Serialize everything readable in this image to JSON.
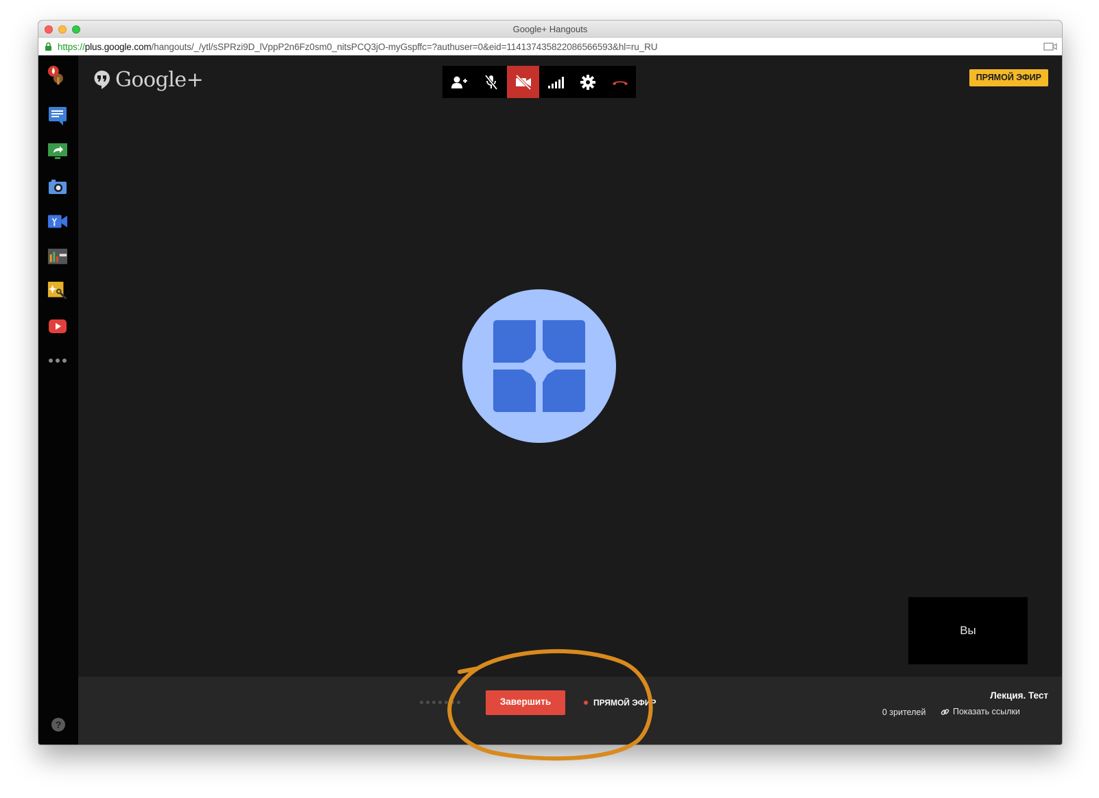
{
  "window": {
    "title": "Google+ Hangouts",
    "url_scheme": "https://",
    "url_host": "plus.google.com",
    "url_path": "/hangouts/_/ytl/sSPRzi9D_lVppP2n6Fz0sm0_nitsPCQ3jO-myGspffc=?authuser=0&eid=114137435822086566593&hl=ru_RU"
  },
  "sidebar": {
    "items": [
      {
        "name": "apps-launcher-icon"
      },
      {
        "name": "chat-icon"
      },
      {
        "name": "screenshare-icon"
      },
      {
        "name": "capture-icon"
      },
      {
        "name": "remote-desktop-icon"
      },
      {
        "name": "control-room-icon"
      },
      {
        "name": "effects-icon"
      },
      {
        "name": "youtube-icon"
      },
      {
        "name": "more-icon"
      }
    ],
    "help_label": "?"
  },
  "header": {
    "logo_text": "Google+",
    "live_badge": "ПРЯМОЙ ЭФИР"
  },
  "toolbar": {
    "buttons": [
      "invite-people-icon",
      "mute-microphone-icon",
      "camera-off-icon",
      "bandwidth-icon",
      "settings-icon",
      "hang-up-icon"
    ],
    "active": "camera-off-icon",
    "active_color": "#c5322b"
  },
  "main": {
    "self_view_label": "Вы"
  },
  "bottom": {
    "end_button": "Завершить",
    "live_label": "ПРЯМОЙ ЭФИР",
    "event_title": "Лекция. Тест",
    "viewers": "0 зрителей",
    "show_links": "Показать ссылки"
  },
  "colors": {
    "accent_live": "#f5b928",
    "end_button": "#e2493d",
    "annotation": "#d98a1e",
    "avatar_bg": "#a4c3ff",
    "avatar_fg": "#3f6fd8"
  }
}
